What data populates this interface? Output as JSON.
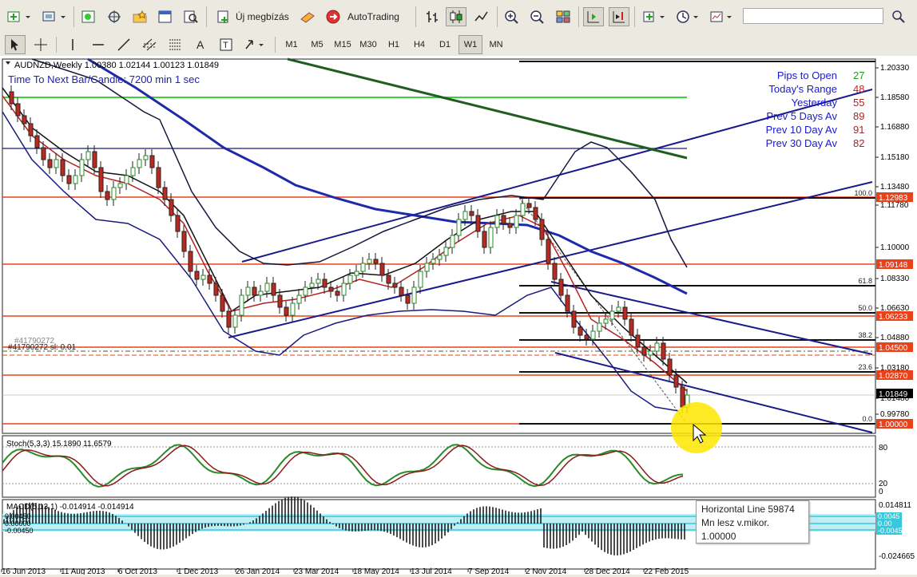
{
  "toolbar": {
    "new_order_label": "Új megbízás",
    "autotrading_label": "AutoTrading",
    "timeframes": [
      "M1",
      "M5",
      "M15",
      "M30",
      "H1",
      "H4",
      "D1",
      "W1",
      "MN"
    ],
    "active_timeframe": "W1"
  },
  "chart": {
    "symbol_header": "AUDNZD,Weekly  1.00380 1.02144 1.00123 1.01849",
    "timer_text": "Time To Next Bar/Candle: 7200 min 1 sec",
    "order_label": "#41790272 sl: 0.01",
    "order_label_dup": "#41790272",
    "info_panel": [
      {
        "label": "Pips to Open",
        "value": "27",
        "label_color": "#1a1acc",
        "value_color": "#22a022"
      },
      {
        "label": "Today's Range",
        "value": "48",
        "label_color": "#1a1acc",
        "value_color": "#cc2222"
      },
      {
        "label": "Yesterday",
        "value": "55",
        "label_color": "#1a1acc",
        "value_color": "#aa2222"
      },
      {
        "label": "Prev 5 Days Av",
        "value": "89",
        "label_color": "#1a1acc",
        "value_color": "#aa2222"
      },
      {
        "label": "Prev 10 Day Av",
        "value": "91",
        "label_color": "#1a1acc",
        "value_color": "#aa2222"
      },
      {
        "label": "Prev 30 Day Av",
        "value": "82",
        "label_color": "#1a1acc",
        "value_color": "#aa2222"
      }
    ],
    "price_axis": [
      "1.20330",
      "1.18580",
      "1.16880",
      "1.15180",
      "1.13480",
      "1.11780",
      "1.10000",
      "1.08330",
      "1.06630",
      "1.04880",
      "1.03180",
      "1.01480",
      "0.99780"
    ],
    "price_tags": [
      {
        "text": "1.12983",
        "color": "#e8421c"
      },
      {
        "text": "1.09148",
        "color": "#e8421c"
      },
      {
        "text": "1.06233",
        "color": "#e8421c"
      },
      {
        "text": "1.04500",
        "color": "#e8421c"
      },
      {
        "text": "1.02870",
        "color": "#e8421c"
      },
      {
        "text": "1.01849",
        "color": "#000000"
      },
      {
        "text": "1.00000",
        "color": "#e8421c"
      }
    ],
    "fibo_levels": [
      "100.0",
      "61.8",
      "50.0",
      "38.2",
      "23.6",
      "0.0"
    ],
    "date_axis": [
      "16 Jun 2013",
      "11 Aug 2013",
      "6 Oct 2013",
      "1 Dec 2013",
      "26 Jan 2014",
      "23 Mar 2014",
      "18 May 2014",
      "13 Jul 2014",
      "7 Sep 2014",
      "2 Nov 2014",
      "28 Dec 2014",
      "22 Feb 2015"
    ]
  },
  "stoch": {
    "label": "Stoch(5,3,3) 15.1890 11.6579",
    "levels": [
      "80",
      "20",
      "0"
    ]
  },
  "macd": {
    "label": "MACD(5,13,1) -0.014914 -0.014914",
    "top_value": "0.014811",
    "zero_value": "0.00",
    "bottom_value": "-0.024665",
    "cyan_tags": [
      "0.0045",
      "0.00",
      "-0.0045"
    ],
    "left_overlay": [
      "0.00450",
      "0.00000",
      "-0.00450"
    ]
  },
  "tooltip": {
    "line1": "Horizontal Line 59874",
    "line2": "Mn lesz v.mikor.",
    "line3": "1.00000"
  }
}
